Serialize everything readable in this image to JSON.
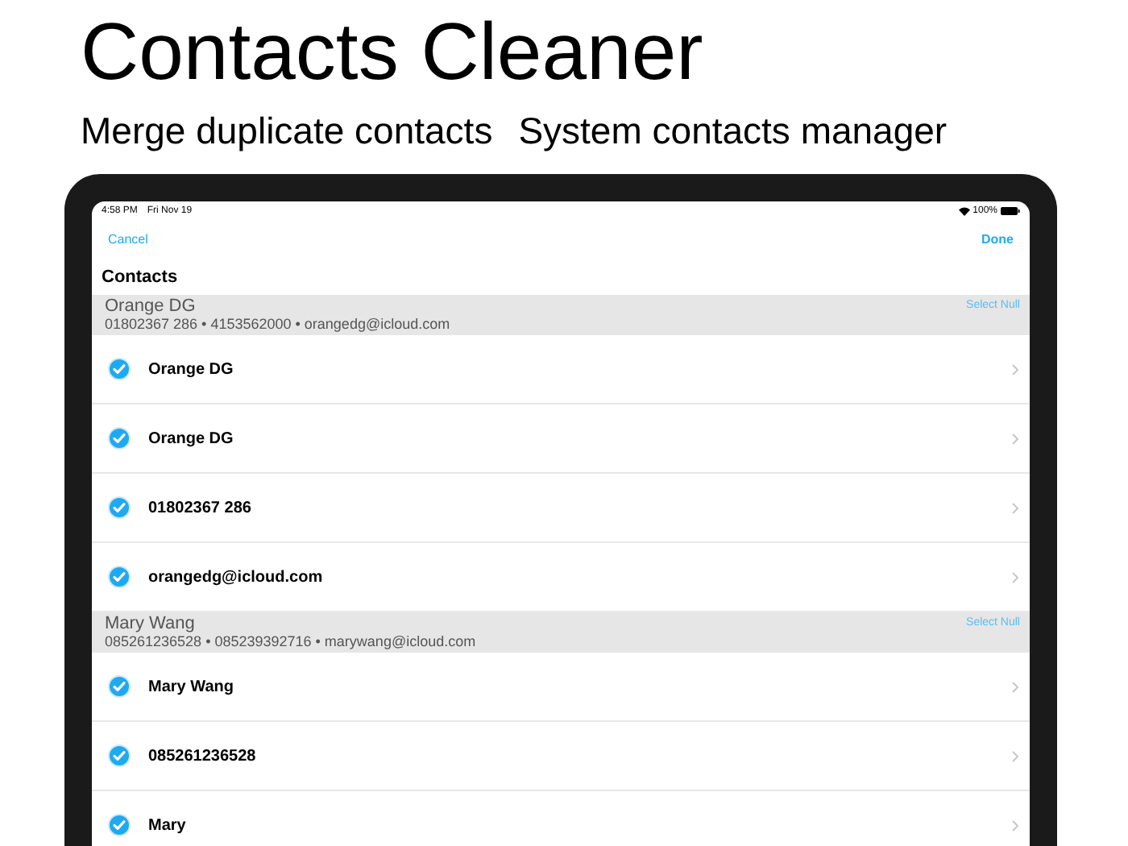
{
  "headline": "Contacts Cleaner",
  "subtitles": [
    "Merge duplicate contacts",
    "System contacts manager"
  ],
  "status_bar": {
    "time": "4:58 PM",
    "date": "Fri Nov 19",
    "battery": "100%"
  },
  "nav": {
    "left": "Cancel",
    "right": "Done"
  },
  "title": "Contacts",
  "groups": [
    {
      "name": "Orange DG",
      "details": "01802367 286 • 4153562000 • orangedg@icloud.com",
      "action": "Select Null",
      "items": [
        {
          "label": "Orange DG",
          "checked": true
        },
        {
          "label": "Orange DG",
          "checked": true
        },
        {
          "label": "01802367 286",
          "checked": true
        },
        {
          "label": "orangedg@icloud.com",
          "checked": true
        }
      ]
    },
    {
      "name": "Mary Wang",
      "details": "085261236528 • 085239392716 • marywang@icloud.com",
      "action": "Select Null",
      "items": [
        {
          "label": "Mary Wang",
          "checked": true
        },
        {
          "label": "085261236528",
          "checked": true
        },
        {
          "label": "Mary",
          "checked": true
        }
      ]
    }
  ]
}
